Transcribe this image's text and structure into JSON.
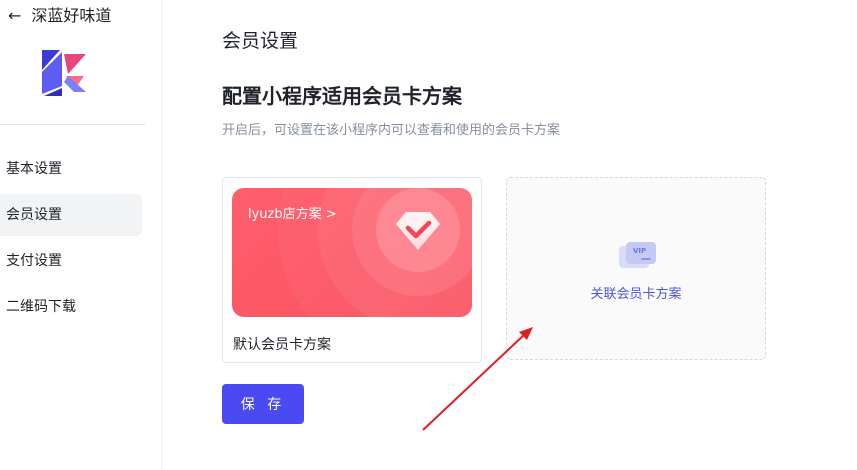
{
  "sidebar": {
    "back_icon": "arrow-left-icon",
    "store_name": "深蓝好味道",
    "items": [
      {
        "label": "基本设置",
        "active": false
      },
      {
        "label": "会员设置",
        "active": true
      },
      {
        "label": "支付设置",
        "active": false
      },
      {
        "label": "二维码下载",
        "active": false
      }
    ]
  },
  "main": {
    "page_title": "会员设置",
    "section_title": "配置小程序适用会员卡方案",
    "section_desc": "开启后，可设置在该小程序内可以查看和使用的会员卡方案",
    "plan_card": {
      "link_text": "lyuzb店方案",
      "chevron": ">",
      "name": "默认会员卡方案",
      "color": "#f94f5e"
    },
    "link_card": {
      "icon": "vip-card-icon",
      "icon_text": "VIP",
      "label": "关联会员卡方案"
    },
    "save_label": "保 存"
  },
  "colors": {
    "primary": "#4b49f1",
    "annotation_arrow": "#e02020"
  }
}
